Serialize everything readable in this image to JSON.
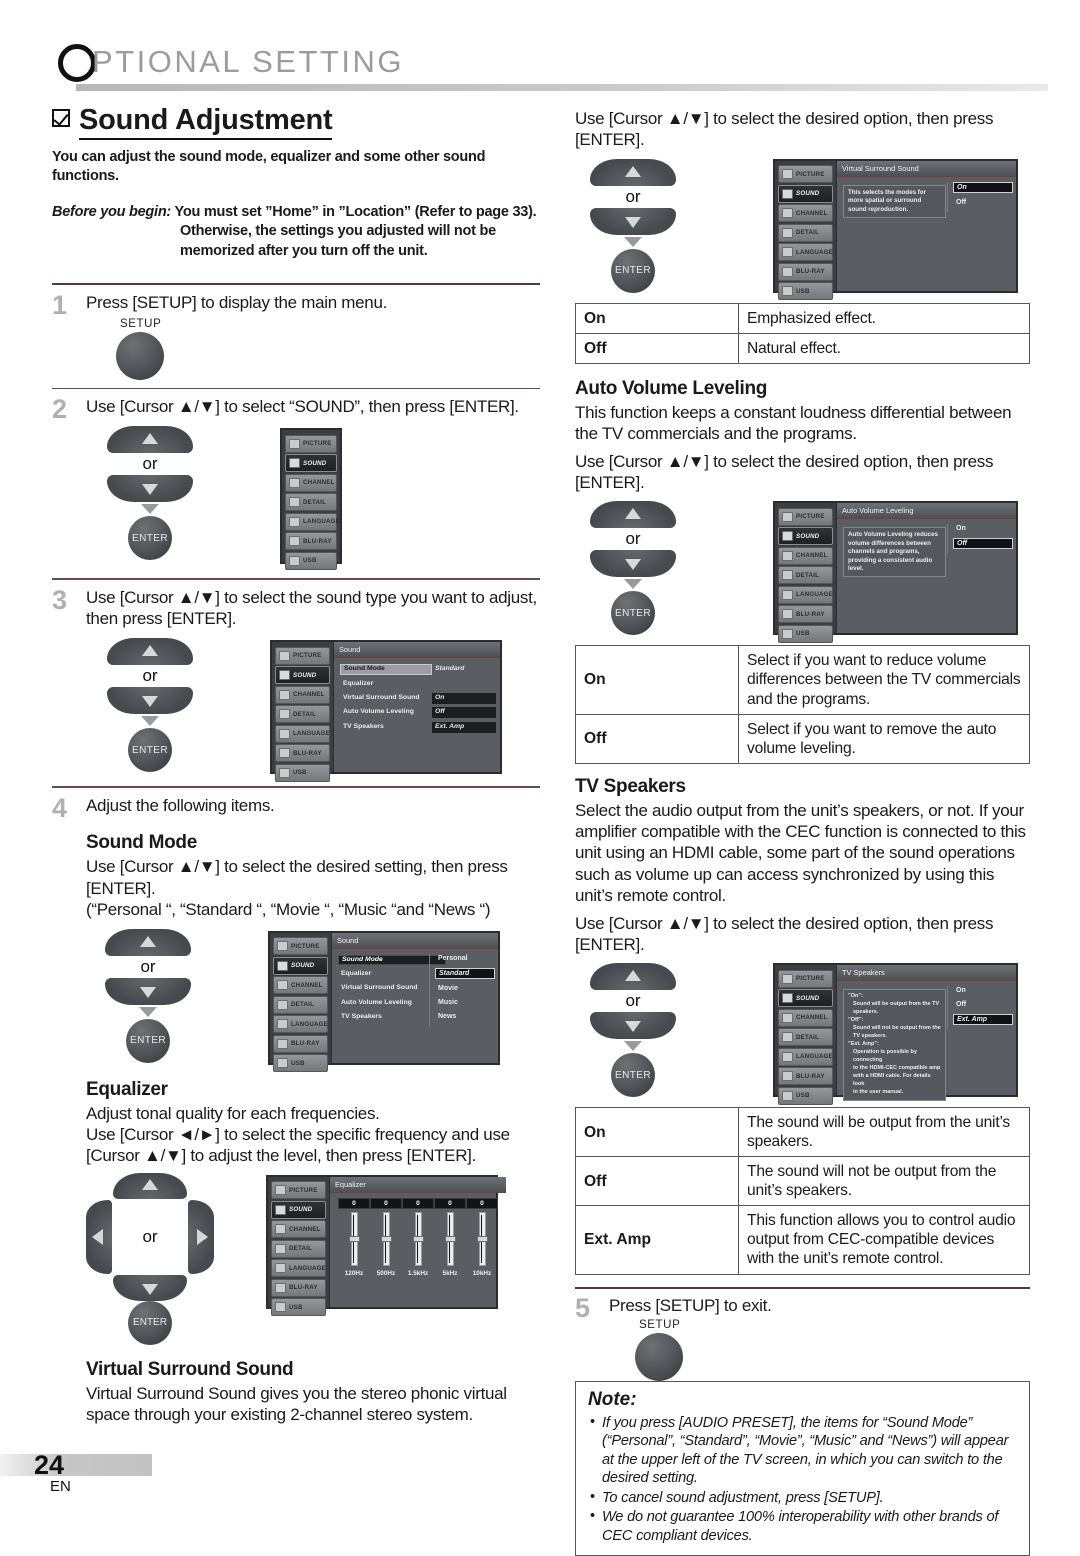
{
  "header": {
    "drop_cap": "O",
    "title": "PTIONAL  SETTING"
  },
  "section": {
    "title": "Sound Adjustment",
    "lead": "You can adjust the sound mode, equalizer and some other sound functions.",
    "before_label": "Before you begin:",
    "before_line1": " You must set ”Home” in ”Location” (Refer to page 33).",
    "before_line2": "Otherwise, the settings you adjusted will not be",
    "before_line3": "memorized after you turn off the unit."
  },
  "steps": {
    "s1_num": "1",
    "s1_text": "Press [SETUP] to display the main menu.",
    "s2_num": "2",
    "s2_text": "Use [Cursor ▲/▼] to select “SOUND”, then press [ENTER].",
    "s3_num": "3",
    "s3_text": "Use [Cursor ▲/▼] to select the sound type you want to adjust, then press [ENTER].",
    "s4_num": "4",
    "s4_text": "Adjust the following items.",
    "s5_num": "5",
    "s5_text": "Press [SETUP] to exit."
  },
  "buttons": {
    "setup_label": "SETUP",
    "enter_label": "ENTER",
    "or_label": "or"
  },
  "osd_menu_items": [
    "PICTURE",
    "SOUND",
    "CHANNEL",
    "DETAIL",
    "LANGUAGE",
    "BLU-RAY",
    "USB"
  ],
  "osd_sound": {
    "title": "Sound",
    "rows": [
      {
        "name": "Sound Mode",
        "value": "Standard"
      },
      {
        "name": "Equalizer",
        "value": ""
      },
      {
        "name": "Virtual Surround Sound",
        "value": "On"
      },
      {
        "name": "Auto Volume Leveling",
        "value": "Off"
      },
      {
        "name": "TV Speakers",
        "value": "Ext. Amp"
      }
    ]
  },
  "osd_sound_mode": {
    "title": "Sound",
    "rows": [
      "Sound Mode",
      "Equalizer",
      "Virtual Surround Sound",
      "Auto Volume Leveling",
      "TV Speakers"
    ],
    "options": [
      "Personal",
      "Standard",
      "Movie",
      "Music",
      "News"
    ],
    "selected": "Standard"
  },
  "osd_equalizer": {
    "title": "Equalizer",
    "bands": [
      "120Hz",
      "500Hz",
      "1.5kHz",
      "5kHz",
      "10kHz"
    ],
    "values": [
      "0",
      "0",
      "0",
      "0",
      "0"
    ]
  },
  "osd_vss": {
    "title": "Virtual Surround Sound",
    "description": "This selects the modes for more spatial or surround sound reproduction.",
    "options": [
      "On",
      "Off"
    ],
    "selected": "On"
  },
  "osd_avl": {
    "title": "Auto Volume Leveling",
    "description": "Auto Volume Leveling reduces volume differences between channels and programs, providing a consistent audio level.",
    "options": [
      "On",
      "Off"
    ],
    "selected": "Off"
  },
  "osd_tvspk": {
    "title": "TV Speakers",
    "description": "”On”: Sound will be output from the TV speakers. ”Off”: Sound will not be output from the TV speakers. ”Ext. Amp”: Operation is possible by connecting to the HDMI-CEC compatible amp with a HDMI cable. For details look in the user manual.",
    "desc_lines": [
      "”On”:",
      "Sound will be output from the TV",
      "speakers.",
      "”Off”:",
      "Sound will not be output from the",
      "TV speakers.",
      "”Ext. Amp”:",
      "Operation is possible by connecting",
      "to the HDMI-CEC compatible amp",
      "with a HDMI cable. For details look",
      "in the user manual."
    ],
    "options": [
      "On",
      "Off",
      "Ext. Amp"
    ],
    "selected": "Ext. Amp"
  },
  "sound_mode": {
    "heading": "Sound Mode",
    "line1": "Use [Cursor ▲/▼] to select the desired setting, then press [ENTER].",
    "line2": "(“Personal “, “Standard “, “Movie “, “Music “and “News “)"
  },
  "equalizer": {
    "heading": "Equalizer",
    "line1": "Adjust tonal quality for each frequencies.",
    "line2": "Use [Cursor ◄/►] to select the specific frequency and use [Cursor ▲/▼] to adjust the level, then press [ENTER]."
  },
  "vss": {
    "heading": "Virtual Surround Sound",
    "body": "Virtual Surround Sound gives you the stereo phonic virtual space through your existing 2-channel stereo system."
  },
  "right_top": {
    "instruction": "Use [Cursor ▲/▼] to select the desired option, then press [ENTER]."
  },
  "vss_table": {
    "rows": [
      {
        "k": "On",
        "v": "Emphasized effect."
      },
      {
        "k": "Off",
        "v": "Natural effect."
      }
    ]
  },
  "avl": {
    "heading": "Auto Volume Leveling",
    "body": "This function keeps a constant loudness differential between the TV commercials and the programs.",
    "instruction": "Use [Cursor ▲/▼] to select the desired option, then press [ENTER]."
  },
  "avl_table": {
    "rows": [
      {
        "k": "On",
        "v": "Select if you want to reduce volume differences between the TV commercials and the programs."
      },
      {
        "k": "Off",
        "v": "Select if you want to remove the auto volume leveling."
      }
    ]
  },
  "tvspk": {
    "heading": "TV Speakers",
    "body": "Select the audio output from the unit’s speakers, or not. If your amplifier compatible with the CEC function is connected to this unit using an HDMI cable, some part of the sound operations such as volume up can access synchronized by using this unit’s remote control.",
    "instruction": "Use [Cursor ▲/▼] to select the desired option, then press [ENTER]."
  },
  "tvspk_table": {
    "rows": [
      {
        "k": "On",
        "v": "The sound will be output from the unit’s speakers."
      },
      {
        "k": "Off",
        "v": "The sound will not be output from the unit’s speakers."
      },
      {
        "k": "Ext. Amp",
        "v": "This function allows you to control audio output from CEC-compatible devices with the unit’s remote control."
      }
    ]
  },
  "note": {
    "title": "Note:",
    "items": [
      "If you press [AUDIO PRESET], the items for “Sound Mode” (“Personal”, “Standard”, “Movie”, “Music” and “News”) will appear at the upper left of the TV screen, in which you can switch to the desired setting.",
      "To cancel sound adjustment, press [SETUP].",
      "We do not guarantee 100% interoperability with other brands of CEC compliant devices."
    ]
  },
  "footer": {
    "page_number": "24",
    "lang": "EN"
  }
}
